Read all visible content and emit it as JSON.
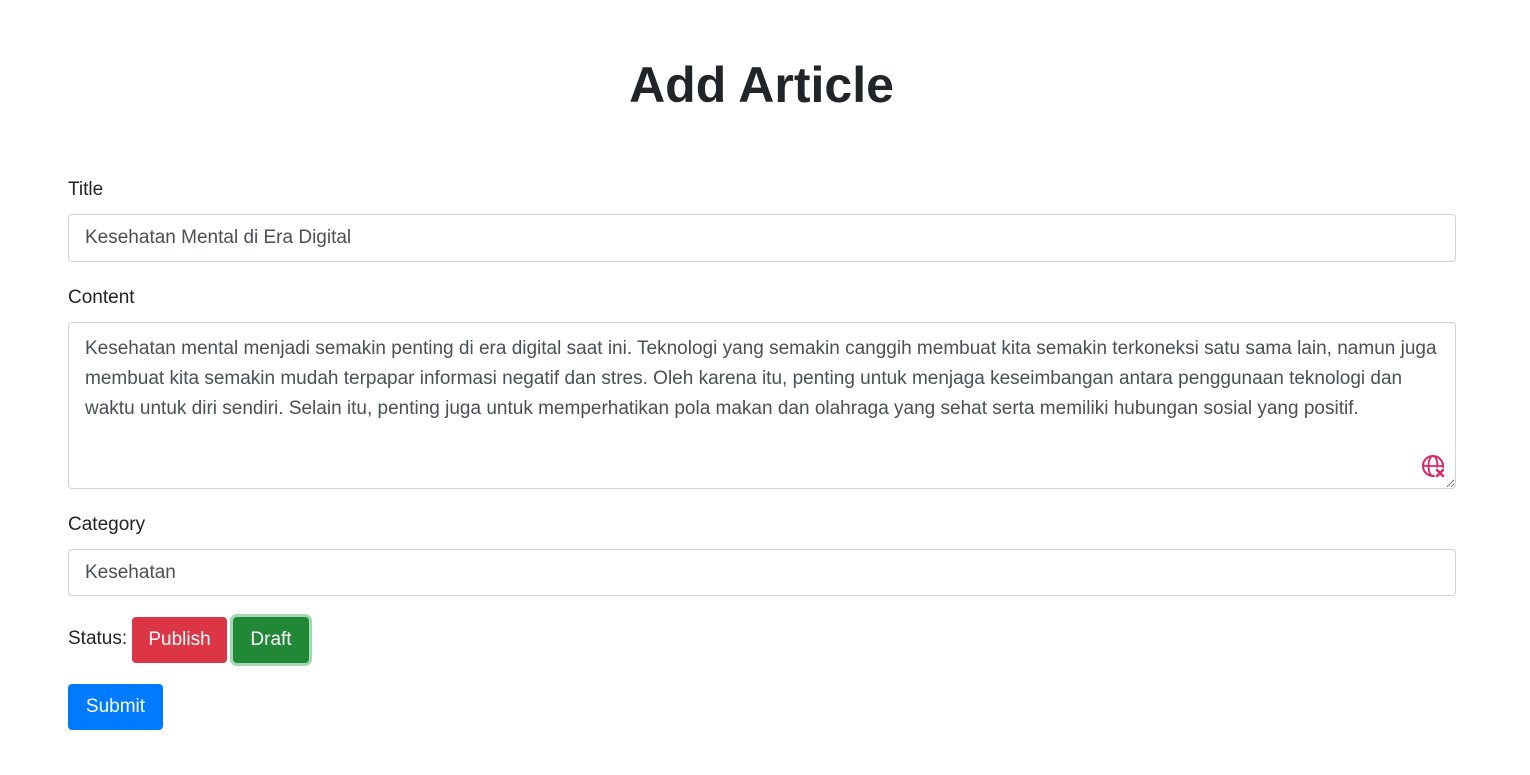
{
  "header": {
    "title": "Add Article"
  },
  "form": {
    "title": {
      "label": "Title",
      "value": "Kesehatan Mental di Era Digital"
    },
    "content": {
      "label": "Content",
      "value": "Kesehatan mental menjadi semakin penting di era digital saat ini. Teknologi yang semakin canggih membuat kita semakin terkoneksi satu sama lain, namun juga membuat kita semakin mudah terpapar informasi negatif dan stres. Oleh karena itu, penting untuk menjaga keseimbangan antara penggunaan teknologi dan waktu untuk diri sendiri. Selain itu, penting juga untuk memperhatikan pola makan dan olahraga yang sehat serta memiliki hubungan sosial yang positif."
    },
    "category": {
      "label": "Category",
      "value": "Kesehatan"
    },
    "status": {
      "label": "Status:",
      "publish_label": "Publish",
      "draft_label": "Draft",
      "selected": "Draft"
    },
    "submit_label": "Submit"
  },
  "icons": {
    "grammar_check": "grammar-check-error-icon"
  },
  "colors": {
    "publish": "#dc3545",
    "draft": "#218838",
    "submit": "#007bff",
    "grammar_icon": "#e0245e"
  }
}
